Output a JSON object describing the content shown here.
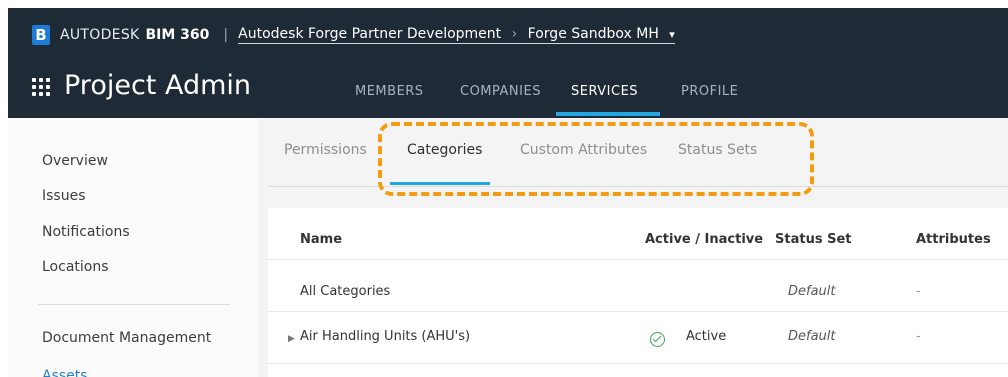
{
  "header": {
    "brand": "AUTODESK",
    "product": "BIM 360",
    "account": "Autodesk Forge Partner Development",
    "project": "Forge Sandbox MH",
    "separator": "|",
    "crumb_arrow": "›",
    "caret": "▾"
  },
  "page_title": "Project Admin",
  "nav": {
    "members": "MEMBERS",
    "companies": "COMPANIES",
    "services": "SERVICES",
    "profile": "PROFILE",
    "active": "SERVICES"
  },
  "sidebar": {
    "items": [
      "Overview",
      "Issues",
      "Notifications",
      "Locations",
      "Document Management",
      "Assets"
    ]
  },
  "subtabs": {
    "items": [
      "Permissions",
      "Categories",
      "Custom Attributes",
      "Status Sets"
    ],
    "active": "Categories"
  },
  "table": {
    "headers": [
      "Name",
      "Active / Inactive",
      "Status Set",
      "Attributes"
    ],
    "rows": [
      {
        "name": "All Categories",
        "active": "",
        "status_set": "Default",
        "attributes": "-"
      },
      {
        "name": "Air Handling Units (AHU's)",
        "active": "Active",
        "status_set": "Default",
        "attributes": "-"
      }
    ]
  },
  "colors": {
    "header_bg": "#1e2a36",
    "accent": "#22a7e0",
    "highlight": "#f39c12",
    "active_green": "#3aa55a",
    "link_blue": "#2a7fc9"
  },
  "icons": [
    "bim360-logo-icon",
    "apps-grid-icon",
    "chevron-down-icon",
    "expand-arrow-icon",
    "check-circle-icon"
  ]
}
